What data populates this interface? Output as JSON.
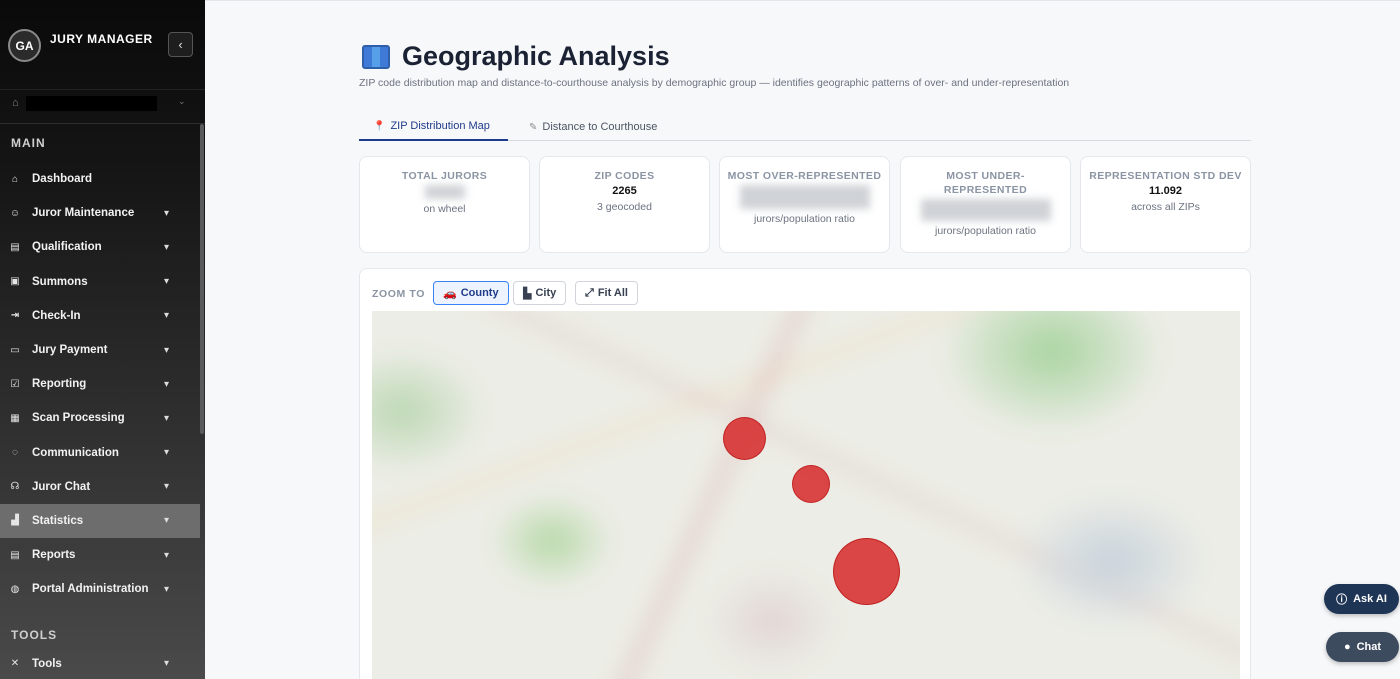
{
  "app": {
    "initials": "GA",
    "title": "JURY MANAGER"
  },
  "sidebar": {
    "main_label": "MAIN",
    "items": [
      {
        "label": "Dashboard",
        "icon": "home-icon"
      },
      {
        "label": "Juror Maintenance",
        "icon": "users-icon"
      },
      {
        "label": "Qualification",
        "icon": "id-card-icon"
      },
      {
        "label": "Summons",
        "icon": "inbox-icon"
      },
      {
        "label": "Check-In",
        "icon": "sign-in-icon"
      },
      {
        "label": "Jury Payment",
        "icon": "payment-icon"
      },
      {
        "label": "Reporting",
        "icon": "calendar-check-icon"
      },
      {
        "label": "Scan Processing",
        "icon": "document-scan-icon"
      },
      {
        "label": "Communication",
        "icon": "message-icon"
      },
      {
        "label": "Juror Chat",
        "icon": "headset-icon"
      },
      {
        "label": "Statistics",
        "icon": "bar-chart-icon"
      },
      {
        "label": "Reports",
        "icon": "report-icon"
      },
      {
        "label": "Portal Administration",
        "icon": "globe-icon"
      }
    ],
    "tools_label": "TOOLS",
    "tools_items": [
      {
        "label": "Tools",
        "icon": "tools-icon"
      }
    ],
    "active_item": "Statistics"
  },
  "page": {
    "title": "Geographic Analysis",
    "subtitle": "ZIP code distribution map and distance-to-courthouse analysis by demographic group — identifies geographic patterns of over- and under-representation"
  },
  "tabs": [
    {
      "label": "ZIP Distribution Map",
      "icon": "pin-icon",
      "active": true
    },
    {
      "label": "Distance to Courthouse",
      "icon": "ruler-icon",
      "active": false
    }
  ],
  "stats": {
    "total_jurors": {
      "title": "TOTAL JURORS",
      "note": "on wheel"
    },
    "zip_codes": {
      "title": "ZIP CODES",
      "value": "2265",
      "note": "3 geocoded"
    },
    "most_over": {
      "title": "MOST OVER-REPRESENTED",
      "note": "jurors/population ratio"
    },
    "most_under": {
      "title": "MOST UNDER-\nREPRESENTED",
      "note": "jurors/population ratio"
    },
    "std_dev": {
      "title": "REPRESENTATION STD DEV",
      "value": "11.092",
      "note": "across all ZIPs"
    }
  },
  "map": {
    "zoom_label": "ZOOM TO",
    "buttons": [
      {
        "label": "County",
        "icon": "car-icon",
        "active": true
      },
      {
        "label": "City",
        "icon": "city-icon",
        "active": false
      },
      {
        "label": "Fit All",
        "icon": "expand-icon",
        "active": false
      }
    ],
    "markers": 3
  },
  "fab": {
    "ask_ai": "Ask AI",
    "chat": "Chat"
  },
  "colors": {
    "accent": "#1e3a8a",
    "marker": "#d62828",
    "sidebar_active": "#6d6d6d"
  }
}
